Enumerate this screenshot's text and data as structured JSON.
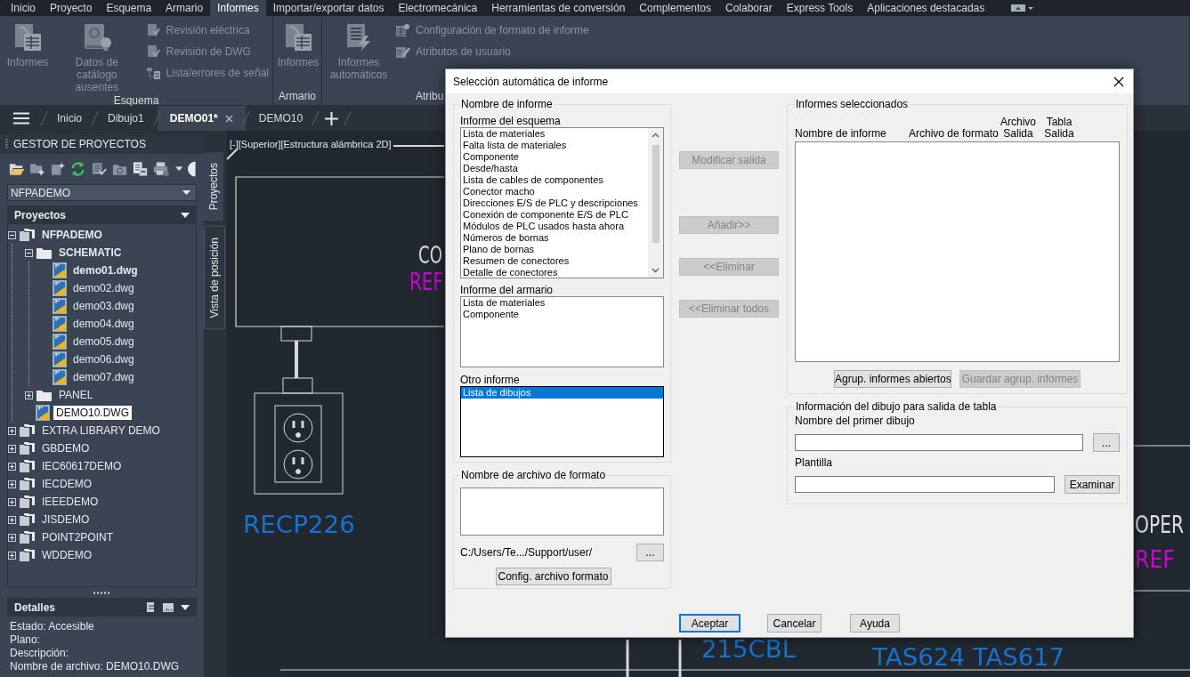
{
  "menu_tabs": [
    {
      "label": "Inicio",
      "selected": false
    },
    {
      "label": "Proyecto",
      "selected": false
    },
    {
      "label": "Esquema",
      "selected": false
    },
    {
      "label": "Armario",
      "selected": false
    },
    {
      "label": "Informes",
      "selected": true
    },
    {
      "label": "Importar/exportar datos",
      "selected": false
    },
    {
      "label": "Electromecánica",
      "selected": false
    },
    {
      "label": "Herramientas de conversión",
      "selected": false
    },
    {
      "label": "Complementos",
      "selected": false
    },
    {
      "label": "Colaborar",
      "selected": false
    },
    {
      "label": "Express Tools",
      "selected": false
    },
    {
      "label": "Aplicaciones destacadas",
      "selected": false
    }
  ],
  "ribbon": {
    "panels": [
      {
        "title": "Esquema",
        "large_buttons": [
          "Informes",
          "Datos de catálogo ausentes"
        ],
        "small_buttons": [
          "Revisión eléctrica",
          "Revisión de DWG",
          "Lista/errores de señal"
        ]
      },
      {
        "title": "Armario",
        "large_buttons": [
          "Informes"
        ]
      },
      {
        "title": "Atribu",
        "large_buttons": [
          "Informes automáticos"
        ],
        "small_buttons": [
          "Configuración de formato de informe",
          "Atributos de usuario"
        ]
      }
    ]
  },
  "file_tabs": [
    {
      "label": "Inicio",
      "selected": false
    },
    {
      "label": "Dibujo1",
      "selected": false
    },
    {
      "label": "DEMO01*",
      "selected": true
    },
    {
      "label": "DEMO10",
      "selected": false
    }
  ],
  "project_manager": {
    "title": "GESTOR DE PROYECTOS",
    "project_dropdown": "NFPADEMO",
    "projects_header": "Proyectos",
    "tree": [
      {
        "label": "NFPADEMO",
        "kind": "project",
        "expanded": true,
        "active": true,
        "selected": false,
        "children": [
          {
            "label": "SCHEMATIC",
            "kind": "folder",
            "expanded": true,
            "active": true,
            "selected": false,
            "children": [
              {
                "label": "demo01.dwg",
                "kind": "drawing",
                "active": true,
                "selected": false
              },
              {
                "label": "demo02.dwg",
                "kind": "drawing",
                "active": false,
                "selected": false
              },
              {
                "label": "demo03.dwg",
                "kind": "drawing",
                "active": false,
                "selected": false
              },
              {
                "label": "demo04.dwg",
                "kind": "drawing",
                "active": false,
                "selected": false
              },
              {
                "label": "demo05.dwg",
                "kind": "drawing",
                "active": false,
                "selected": false
              },
              {
                "label": "demo06.dwg",
                "kind": "drawing",
                "active": false,
                "selected": false
              },
              {
                "label": "demo07.dwg",
                "kind": "drawing",
                "active": false,
                "selected": false
              }
            ]
          },
          {
            "label": "PANEL",
            "kind": "folder",
            "expanded": false,
            "active": false,
            "selected": false
          },
          {
            "label": "DEMO10.DWG",
            "kind": "drawing",
            "active": false,
            "selected": true
          }
        ]
      },
      {
        "label": "EXTRA LIBRARY DEMO",
        "kind": "project",
        "expanded": false,
        "active": false,
        "selected": false
      },
      {
        "label": "GBDEMO",
        "kind": "project",
        "expanded": false,
        "active": false,
        "selected": false
      },
      {
        "label": "IEC60617DEMO",
        "kind": "project",
        "expanded": false,
        "active": false,
        "selected": false
      },
      {
        "label": "IECDEMO",
        "kind": "project",
        "expanded": false,
        "active": false,
        "selected": false
      },
      {
        "label": "IEEEDEMO",
        "kind": "project",
        "expanded": false,
        "active": false,
        "selected": false
      },
      {
        "label": "JISDEMO",
        "kind": "project",
        "expanded": false,
        "active": false,
        "selected": false
      },
      {
        "label": "POINT2POINT",
        "kind": "project",
        "expanded": false,
        "active": false,
        "selected": false
      },
      {
        "label": "WDDEMO",
        "kind": "project",
        "expanded": false,
        "active": false,
        "selected": false
      }
    ],
    "details_header": "Detalles",
    "details": [
      "Estado: Accesible",
      "Plano:",
      "Descripción:",
      "Nombre de archivo: DEMO10.DWG"
    ],
    "side_tabs": [
      {
        "label": "Proyectos",
        "selected": true
      },
      {
        "label": "Vista de posición",
        "selected": false
      }
    ]
  },
  "canvas": {
    "viewport_label": "[-][Superior][Estructura alámbrica 2D]",
    "labels": [
      {
        "text": "CO",
        "color": "#dcdcdc"
      },
      {
        "text": "REF",
        "color": "#d000d0"
      },
      {
        "text": "RECP226",
        "color": "#1672d0"
      },
      {
        "text": "OPER",
        "color": "#dcdcdc"
      },
      {
        "text": "REF",
        "color": "#d000d0"
      },
      {
        "text": "215CBL",
        "color": "#1672d0"
      },
      {
        "text": "TAS624",
        "color": "#1672d0"
      },
      {
        "text": "TAS617",
        "color": "#1672d0"
      }
    ]
  },
  "dialog": {
    "title": "Selección automática de informe",
    "report_name_group": {
      "title": "Nombre de informe",
      "lists": [
        {
          "label": "Informe del esquema",
          "items": [
            {
              "text": "Lista de materiales",
              "selected": false
            },
            {
              "text": "Falta lista de materiales",
              "selected": false
            },
            {
              "text": "Componente",
              "selected": false
            },
            {
              "text": "Desde/hasta",
              "selected": false
            },
            {
              "text": "Lista de cables de componentes",
              "selected": false
            },
            {
              "text": "Conector macho",
              "selected": false
            },
            {
              "text": "Direcciones E/S de PLC y descripciones",
              "selected": false
            },
            {
              "text": "Conexión de componente E/S de PLC",
              "selected": false
            },
            {
              "text": "Módulos de PLC usados hasta ahora",
              "selected": false
            },
            {
              "text": "Números de bornas",
              "selected": false
            },
            {
              "text": "Plano de bornas",
              "selected": false
            },
            {
              "text": "Resumen de conectores",
              "selected": false
            },
            {
              "text": "Detalle de conectores",
              "selected": false
            }
          ]
        },
        {
          "label": "Informe del armario",
          "items": [
            {
              "text": "Lista de materiales",
              "selected": false
            },
            {
              "text": "Componente",
              "selected": false
            }
          ]
        },
        {
          "label": "Otro informe",
          "items": [
            {
              "text": "Lista de dibujos",
              "selected": true
            }
          ]
        }
      ]
    },
    "format_group": {
      "title": "Nombre de archivo de formato",
      "path": "C:/Users/Te.../Support/user/",
      "browse_button": "...",
      "config_button": "Config. archivo formato"
    },
    "middle_buttons": [
      {
        "label": "Modificar salida",
        "disabled": true
      },
      {
        "label": "Añadir>>",
        "disabled": true
      },
      {
        "label": "<<Eliminar",
        "disabled": true
      },
      {
        "label": "<<Eliminar todos",
        "disabled": true
      }
    ],
    "selected_group": {
      "title": "Informes seleccionados",
      "columns": [
        "Nombre de informe",
        "Archivo de formato",
        "Archivo Salida",
        "Tabla Salida"
      ],
      "buttons": [
        {
          "label": "Agrup. informes abiertos",
          "disabled": false
        },
        {
          "label": "Guardar agrup. informes",
          "disabled": true
        }
      ]
    },
    "drawing_info_group": {
      "title": "Información del dibujo para salida de tabla",
      "fields": [
        {
          "label": "Nombre del primer dibujo",
          "button": "..."
        },
        {
          "label": "Plantilla",
          "button": "Examinar"
        }
      ]
    },
    "footer_buttons": [
      {
        "label": "Aceptar",
        "default": true
      },
      {
        "label": "Cancelar",
        "default": false
      },
      {
        "label": "Ayuda",
        "default": false
      }
    ]
  }
}
